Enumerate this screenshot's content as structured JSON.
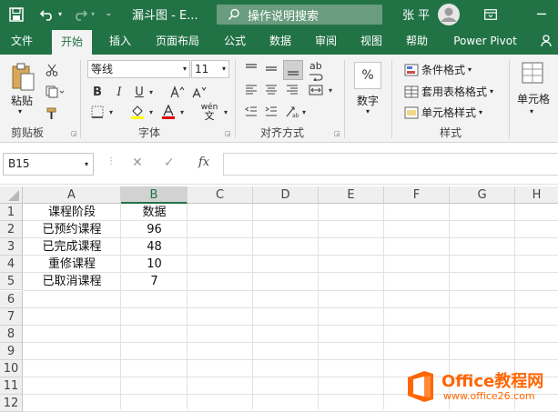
{
  "title_bar": {
    "quick_access_redo_label": "",
    "doc_title": "漏斗图 - E...",
    "search_placeholder": "操作说明搜索",
    "user_name": "张 平"
  },
  "tabs": [
    "文件",
    "开始",
    "插入",
    "页面布局",
    "公式",
    "数据",
    "审阅",
    "视图",
    "帮助",
    "Power Pivot"
  ],
  "active_tab": "开始",
  "ribbon": {
    "clipboard": {
      "paste": "粘贴",
      "group": "剪贴板"
    },
    "font": {
      "font_name": "等线",
      "font_size": "11",
      "group": "字体",
      "bold": "B",
      "italic": "I",
      "underline": "U",
      "phonetic_top": "wén",
      "phonetic_bottom": "文"
    },
    "alignment": {
      "group": "对齐方式",
      "wrap": "ab"
    },
    "number": {
      "percent": "%",
      "label": "数字"
    },
    "styles": {
      "conditional": "条件格式",
      "table": "套用表格格式",
      "cell": "单元格样式",
      "group": "样式"
    },
    "cells": {
      "label": "单元格"
    }
  },
  "formula_bar": {
    "name_box": "B15",
    "fx": "fx",
    "formula": ""
  },
  "sheet": {
    "columns": [
      "A",
      "B",
      "C",
      "D",
      "E",
      "F",
      "G",
      "H"
    ],
    "rows": [
      "1",
      "2",
      "3",
      "4",
      "5",
      "6",
      "7",
      "8",
      "9",
      "10",
      "11",
      "12"
    ],
    "data": [
      [
        "课程阶段",
        "数据"
      ],
      [
        "已预约课程",
        "96"
      ],
      [
        "已完成课程",
        "48"
      ],
      [
        "重修课程",
        "10"
      ],
      [
        "已取消课程",
        "7"
      ]
    ]
  },
  "watermark": {
    "brand_prefix": "Office",
    "brand_suffix": "教程网",
    "url": "www.office26.com"
  },
  "colors": {
    "accent": "#217346",
    "watermark": "#ff6600"
  }
}
